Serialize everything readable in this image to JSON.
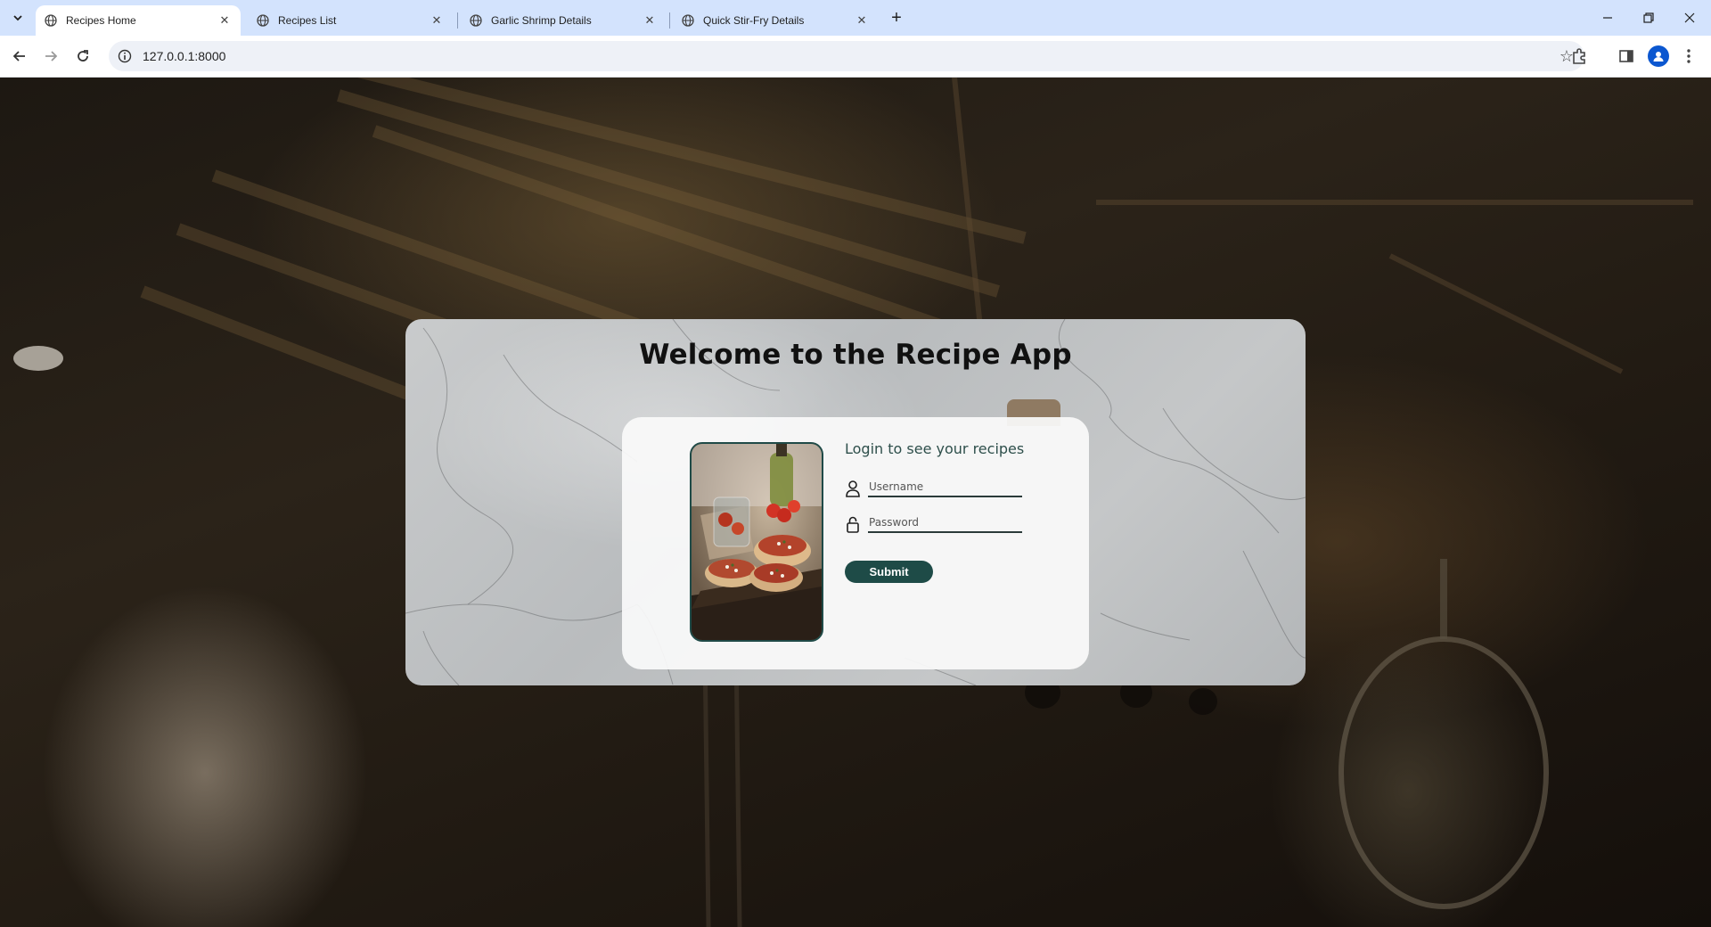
{
  "browser": {
    "tabs": [
      {
        "title": "Recipes Home",
        "active": true
      },
      {
        "title": "Recipes List",
        "active": false
      },
      {
        "title": "Garlic Shrimp Details",
        "active": false
      },
      {
        "title": "Quick Stir-Fry Details",
        "active": false
      }
    ],
    "address": "127.0.0.1:8000"
  },
  "page": {
    "title": "Welcome to the Recipe App",
    "login": {
      "heading": "Login to see your recipes",
      "username_placeholder": "Username",
      "password_placeholder": "Password",
      "submit_label": "Submit"
    }
  },
  "colors": {
    "accent": "#1e4b47",
    "tab_strip": "#d3e3fd"
  }
}
